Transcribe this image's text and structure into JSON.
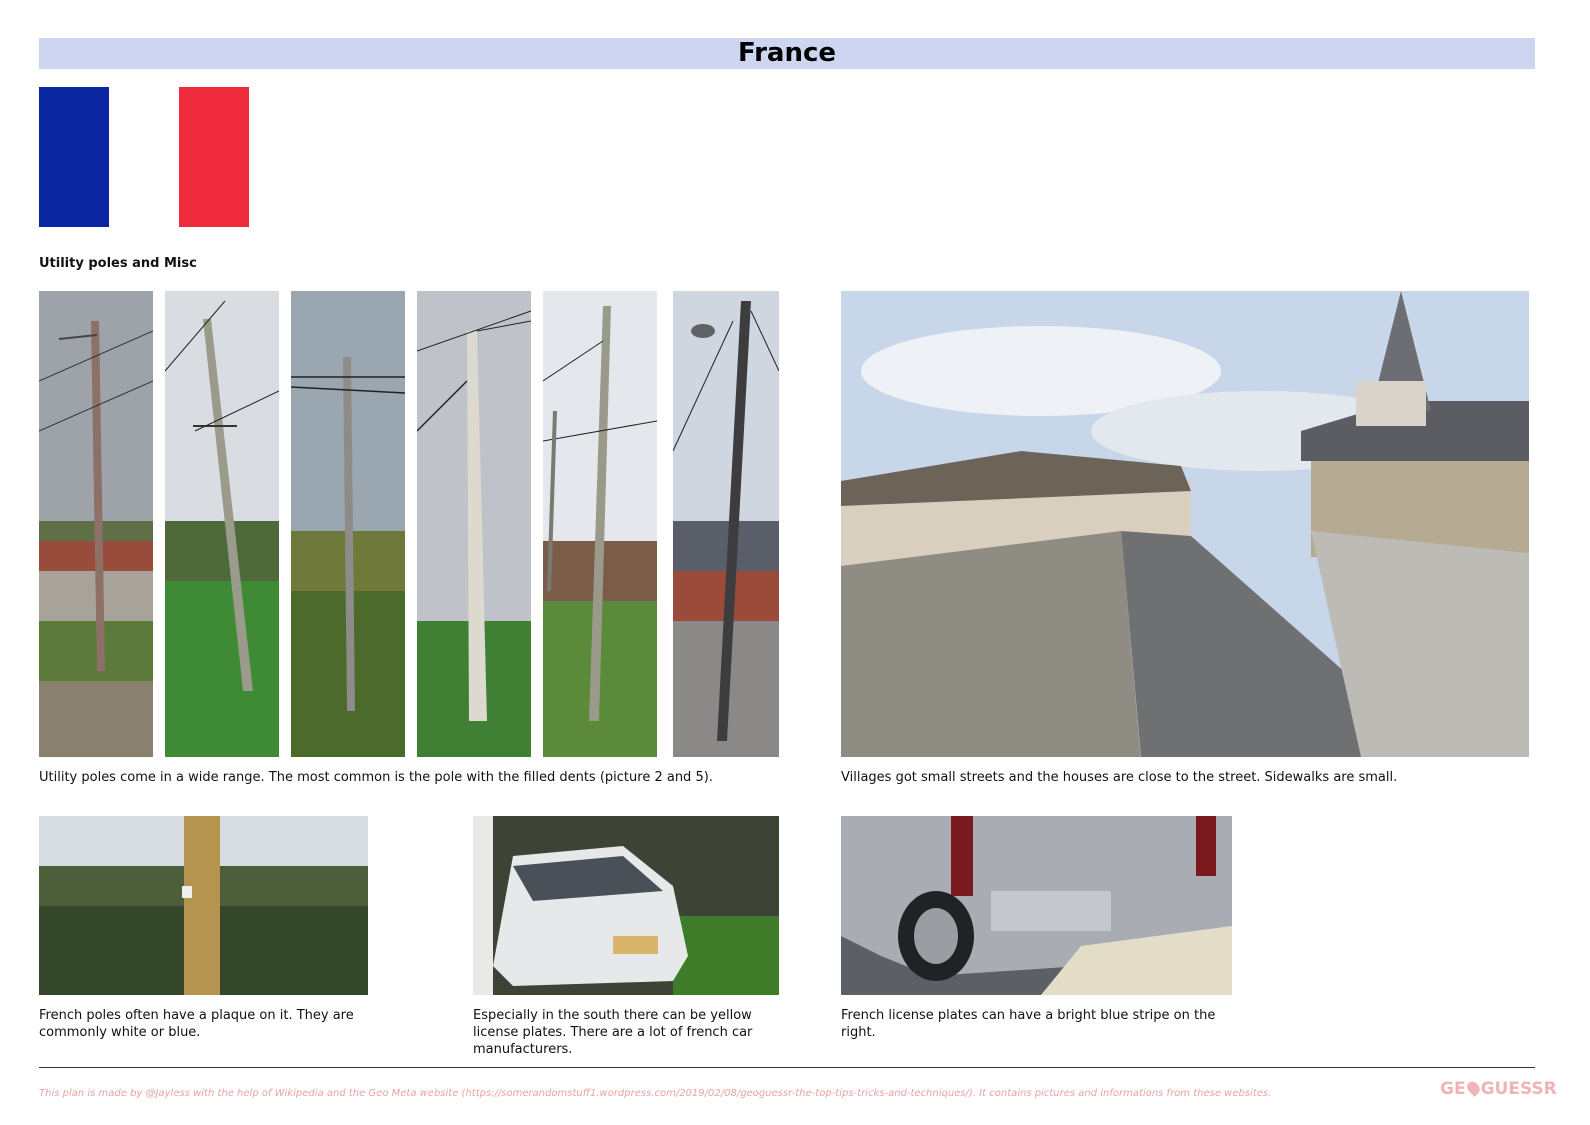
{
  "header": {
    "title": "France"
  },
  "flag": {
    "colors": [
      "#0b24a0",
      "#ffffff",
      "#ef2a3d"
    ]
  },
  "section": {
    "heading": "Utility poles and Misc"
  },
  "captions": {
    "poles": "Utility poles come in a wide range. The most common is the pole with the filled dents (picture 2 and 5).",
    "village": "Villages got small streets and the houses are close to the street. Sidewalks are small.",
    "plaque": "French poles often have a plaque on it. They are commonly white or blue.",
    "yellow_plates": "Especially in the south there can be yellow license plates. There are a lot of french car manufacturers.",
    "blue_stripe": "French license plates can have a bright blue stripe on the right."
  },
  "footer": {
    "text": "This plan is made by @Jayless with the help of Wikipedia and the Geo Meta website (https://somerandomstuff1.wordpress.com/2019/02/08/geoguessr-the-top-tips-tricks-and-techniques/). It contains pictures and informations from these websites.",
    "logo_left": "GE",
    "logo_right": "GUESSR"
  }
}
